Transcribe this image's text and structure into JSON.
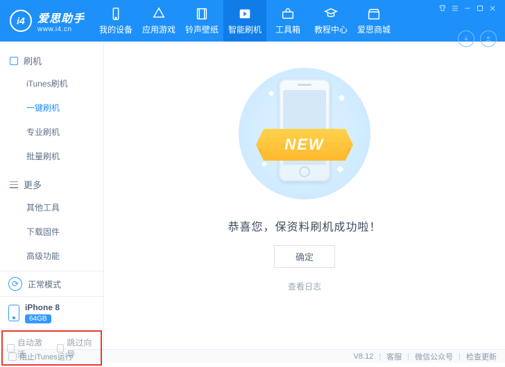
{
  "logo": {
    "mark": "i4",
    "title": "爱思助手",
    "url": "www.i4.cn"
  },
  "nav": [
    {
      "name": "my-device",
      "label": "我的设备"
    },
    {
      "name": "app-games",
      "label": "应用游戏"
    },
    {
      "name": "ringtone-wallpaper",
      "label": "铃声壁纸"
    },
    {
      "name": "smart-flash",
      "label": "智能刷机",
      "active": true
    },
    {
      "name": "toolbox",
      "label": "工具箱"
    },
    {
      "name": "tutorial-center",
      "label": "教程中心"
    },
    {
      "name": "aisi-mall",
      "label": "爱思商城"
    }
  ],
  "sidebar": {
    "flash": {
      "head": "刷机",
      "items": [
        {
          "name": "itunes-flash",
          "label": "iTunes刷机"
        },
        {
          "name": "one-click-flash",
          "label": "一键刷机",
          "active": true
        },
        {
          "name": "pro-flash",
          "label": "专业刷机"
        },
        {
          "name": "batch-flash",
          "label": "批量刷机"
        }
      ]
    },
    "more": {
      "head": "更多",
      "items": [
        {
          "name": "other-tools",
          "label": "其他工具"
        },
        {
          "name": "download-firmware",
          "label": "下载固件"
        },
        {
          "name": "advanced",
          "label": "高级功能"
        }
      ]
    },
    "mode": {
      "label": "正常模式"
    },
    "device": {
      "name": "iPhone 8",
      "storage": "64GB"
    },
    "checks": [
      {
        "name": "auto-activate",
        "label": "自动激活"
      },
      {
        "name": "skip-guide",
        "label": "跳过向导"
      }
    ]
  },
  "main": {
    "ribbon": "NEW",
    "success": "恭喜您，保资料刷机成功啦！",
    "ok": "确定",
    "view_log": "查看日志"
  },
  "footer": {
    "block_itunes": "阻止iTunes运行",
    "version": "V8.12",
    "links": [
      "客服",
      "微信公众号",
      "检查更新"
    ]
  }
}
